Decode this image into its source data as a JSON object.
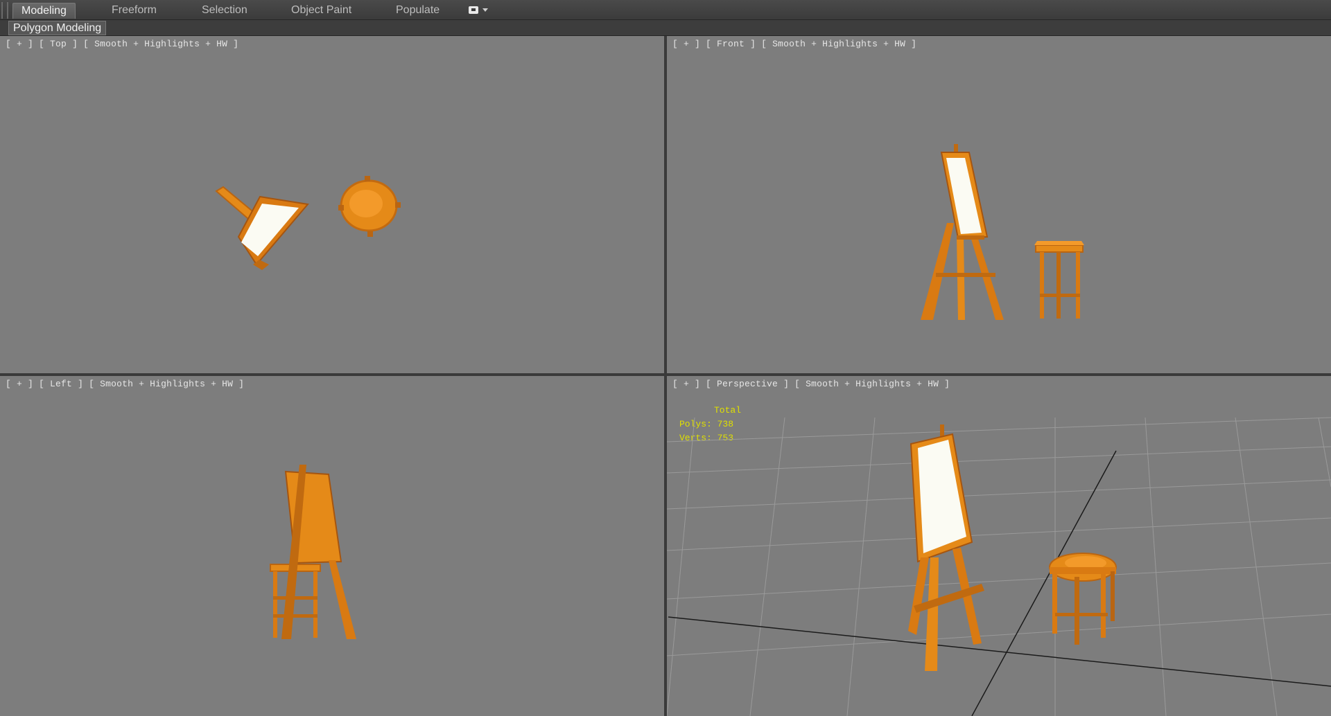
{
  "ribbon": {
    "tabs": [
      {
        "label": "Modeling",
        "active": true
      },
      {
        "label": "Freeform",
        "active": false
      },
      {
        "label": "Selection",
        "active": false
      },
      {
        "label": "Object Paint",
        "active": false
      },
      {
        "label": "Populate",
        "active": false
      }
    ],
    "options_icon": "ribbon-options-icon"
  },
  "panel": {
    "title": "Polygon Modeling"
  },
  "viewports": {
    "top": {
      "plus": "+",
      "view": "Top",
      "shading": "Smooth + Highlights + HW"
    },
    "front": {
      "plus": "+",
      "view": "Front",
      "shading": "Smooth + Highlights + HW"
    },
    "left": {
      "plus": "+",
      "view": "Left",
      "shading": "Smooth + Highlights + HW"
    },
    "perspective": {
      "plus": "+",
      "view": "Perspective",
      "shading": "Smooth + Highlights + HW"
    }
  },
  "stats": {
    "title": "Total",
    "polys_label": "Polys:",
    "polys": "738",
    "verts_label": "Verts:",
    "verts": "753"
  },
  "colors": {
    "viewport_bg": "#7d7d7d",
    "wood": "#e58a18",
    "wood_dark": "#b96512",
    "canvas": "#fbfbf3",
    "stats_text": "#e0e000"
  }
}
